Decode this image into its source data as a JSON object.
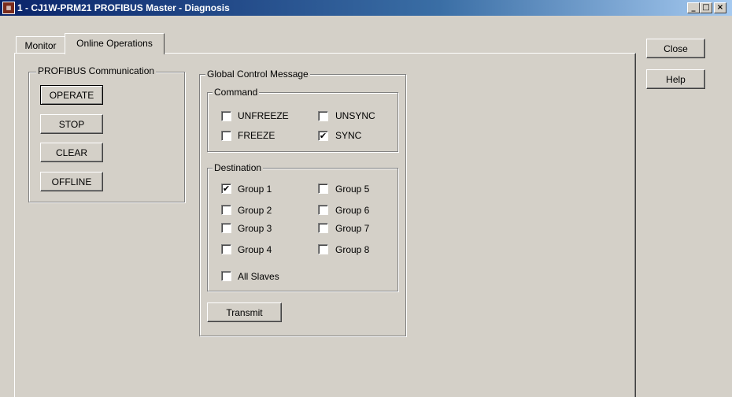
{
  "window": {
    "title": "1 - CJ1W-PRM21 PROFIBUS Master - Diagnosis",
    "icon": "app-icon",
    "controls": {
      "minimize": "_",
      "maximize": "□",
      "close": "×"
    }
  },
  "tabs": [
    {
      "label": "Monitor",
      "selected": false
    },
    {
      "label": "Online Operations",
      "selected": true
    }
  ],
  "profibus_communication": {
    "title": "PROFIBUS Communication",
    "buttons": [
      "OPERATE",
      "STOP",
      "CLEAR",
      "OFFLINE"
    ]
  },
  "global_control": {
    "title": "Global Control Message",
    "command": {
      "title": "Command",
      "items": [
        {
          "label": "UNFREEZE",
          "checked": false
        },
        {
          "label": "UNSYNC",
          "checked": false
        },
        {
          "label": "FREEZE",
          "checked": false
        },
        {
          "label": "SYNC",
          "checked": true
        }
      ]
    },
    "destination": {
      "title": "Destination",
      "items": [
        {
          "label": "Group 1",
          "checked": true
        },
        {
          "label": "Group 5",
          "checked": false
        },
        {
          "label": "Group 2",
          "checked": false
        },
        {
          "label": "Group 6",
          "checked": false
        },
        {
          "label": "Group 3",
          "checked": false
        },
        {
          "label": "Group 7",
          "checked": false
        },
        {
          "label": "Group 4",
          "checked": false
        },
        {
          "label": "Group 8",
          "checked": false
        },
        {
          "label": "All Slaves",
          "checked": false
        }
      ]
    },
    "transmit_label": "Transmit"
  },
  "side_buttons": {
    "close": "Close",
    "help": "Help"
  },
  "check_mark": "✔"
}
